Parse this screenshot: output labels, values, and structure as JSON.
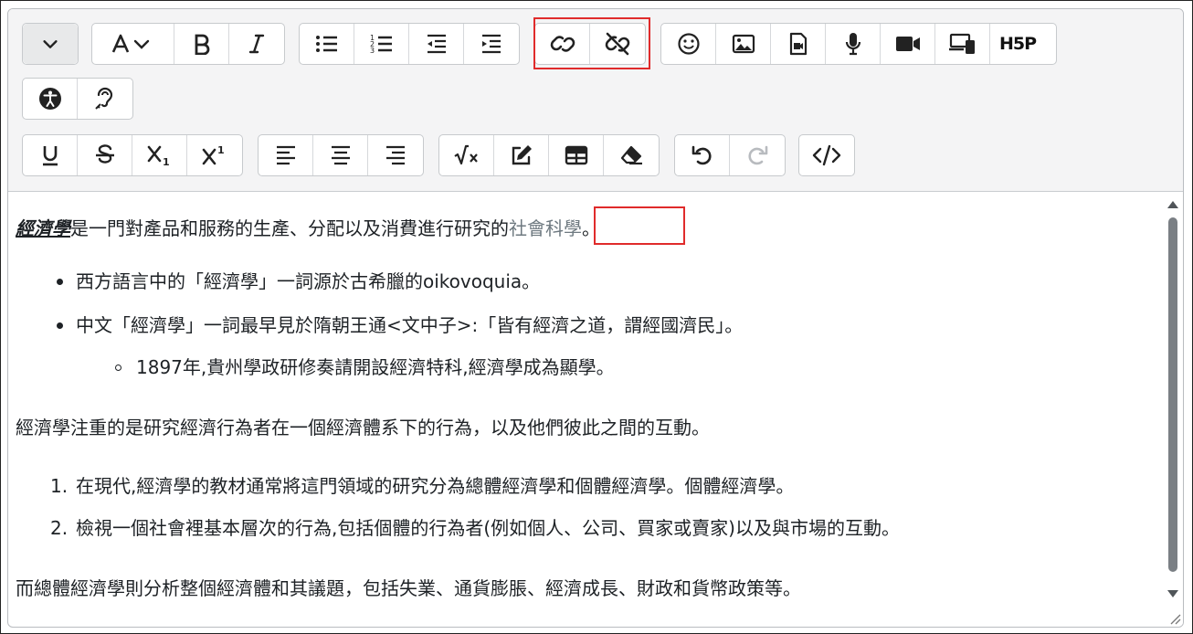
{
  "toolbar": {
    "row1": [
      {
        "icon": "chevron-down-icon",
        "name": "block-style-dropdown"
      },
      {
        "icon": "font-size-icon",
        "name": "font-format-dropdown"
      },
      {
        "icon": "bold-icon",
        "name": "bold-button"
      },
      {
        "icon": "italic-icon",
        "name": "italic-button"
      },
      {
        "icon": "bulleted-list-icon",
        "name": "unordered-list-button"
      },
      {
        "icon": "numbered-list-icon",
        "name": "ordered-list-button"
      },
      {
        "icon": "outdent-icon",
        "name": "outdent-button"
      },
      {
        "icon": "indent-icon",
        "name": "indent-button"
      },
      {
        "icon": "link-icon",
        "name": "link-button"
      },
      {
        "icon": "unlink-icon",
        "name": "unlink-button"
      },
      {
        "icon": "emoji-icon",
        "name": "emoji-button"
      },
      {
        "icon": "image-icon",
        "name": "image-button"
      },
      {
        "icon": "media-file-icon",
        "name": "media-button"
      },
      {
        "icon": "microphone-icon",
        "name": "record-audio-button"
      },
      {
        "icon": "video-camera-icon",
        "name": "record-video-button"
      },
      {
        "icon": "devices-icon",
        "name": "multimedia-button"
      },
      {
        "icon": "h5p-icon",
        "name": "h5p-button",
        "label": "H5P"
      }
    ],
    "row2": [
      {
        "icon": "accessibility-icon",
        "name": "accessibility-checker-button"
      },
      {
        "icon": "screen-reader-icon",
        "name": "screen-reader-helper-button"
      }
    ],
    "row3": [
      {
        "icon": "underline-icon",
        "name": "underline-button"
      },
      {
        "icon": "strikethrough-icon",
        "name": "strikethrough-button"
      },
      {
        "icon": "subscript-icon",
        "name": "subscript-button"
      },
      {
        "icon": "superscript-icon",
        "name": "superscript-button"
      },
      {
        "icon": "align-left-icon",
        "name": "align-left-button"
      },
      {
        "icon": "align-center-icon",
        "name": "align-center-button"
      },
      {
        "icon": "align-right-icon",
        "name": "align-right-button"
      },
      {
        "icon": "equation-icon",
        "name": "equation-button"
      },
      {
        "icon": "edit-pencil-icon",
        "name": "edit-button"
      },
      {
        "icon": "table-icon",
        "name": "table-button"
      },
      {
        "icon": "eraser-icon",
        "name": "clear-formatting-button"
      },
      {
        "icon": "undo-icon",
        "name": "undo-button"
      },
      {
        "icon": "redo-icon",
        "name": "redo-button",
        "disabled": true
      },
      {
        "icon": "code-icon",
        "name": "html-source-button"
      }
    ],
    "highlight_color": "#e02b2b"
  },
  "content": {
    "p1": {
      "title": "經濟學",
      "text": "是一門對產品和服務的生產、分配以及消費進行研究的",
      "link": "社會科學",
      "tail": "。"
    },
    "bullets": [
      "西方語言中的「經濟學」一詞源於古希臘的oikovoquia。",
      "中文「經濟學」一詞最早見於隋朝王通<文中子>:「皆有經濟之道，謂經國濟民」。"
    ],
    "sub_bullets": [
      "1897年,貴州學政研修奏請開設經濟特科,經濟學成為顯學。"
    ],
    "p2": "經濟學注重的是研究經濟行為者在一個經濟體系下的行為，以及他們彼此之間的互動。",
    "ordered": [
      {
        "num": "1.",
        "text": "在現代,經濟學的教材通常將這門領域的研究分為總體經濟學和個體經濟學。個體經濟學。"
      },
      {
        "num": "2.",
        "text": "檢視一個社會裡基本層次的行為,包括個體的行為者(例如個人、公司、買家或賣家)以及與市場的互動。"
      }
    ],
    "p3": "而總體經濟學則分析整個經濟體和其議題，包括失業、通貨膨脹、經濟成長、財政和貨幣政策等。"
  },
  "colors": {
    "text": "#1d2125",
    "link": "#6e7980",
    "toolbar_bg": "#f4f4f5"
  }
}
